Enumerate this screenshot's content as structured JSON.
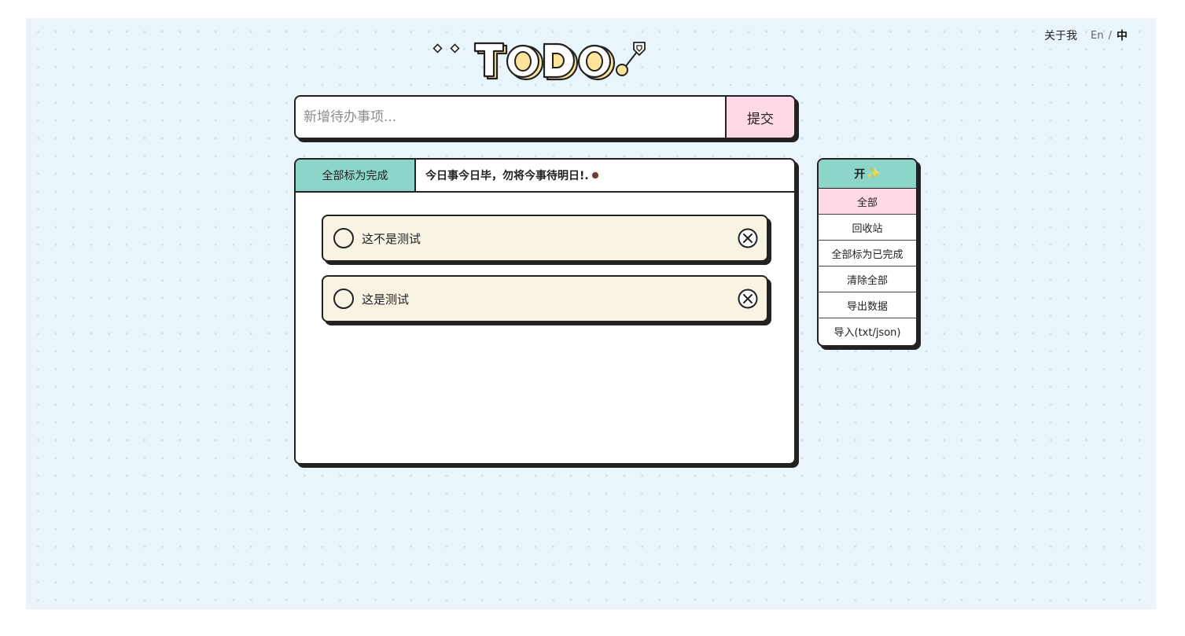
{
  "nav": {
    "about": "关于我",
    "lang_en": "En",
    "lang_sep": "/",
    "lang_zh": "中"
  },
  "logo": {
    "text": "TODO",
    "colors": {
      "fill": "#fde49a",
      "outline": "#222222"
    }
  },
  "input": {
    "placeholder": "新增待办事项...",
    "value": "",
    "submit_label": "提交"
  },
  "toolbar": {
    "mark_all_label": "全部标为完成",
    "motto": "今日事今日毕，勿将今事待明日!."
  },
  "todos": [
    {
      "text": "这不是测试",
      "done": false
    },
    {
      "text": "这是测试",
      "done": false
    }
  ],
  "menu": {
    "toggle_label": "开",
    "toggle_icon": "sparkle-icon",
    "items": [
      {
        "label": "全部",
        "active": true
      },
      {
        "label": "回收站",
        "active": false
      },
      {
        "label": "全部标为已完成",
        "active": false
      },
      {
        "label": "清除全部",
        "active": false
      },
      {
        "label": "导出数据",
        "active": false
      },
      {
        "label": "导入(txt/json)",
        "active": false
      }
    ]
  },
  "colors": {
    "background": "#e9f4fb",
    "accent_teal": "#8dd5c9",
    "accent_pink": "#ffd9e7",
    "todo_bg": "#f9f3e3",
    "border": "#222222"
  }
}
